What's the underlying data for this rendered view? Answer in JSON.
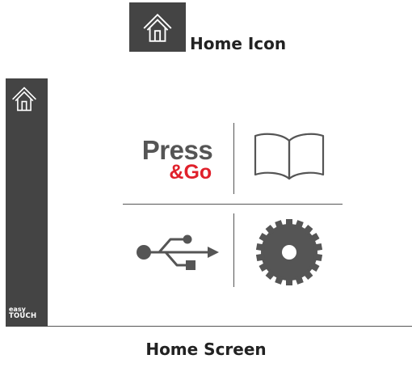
{
  "captions": {
    "icon_caption": "Home Icon",
    "screen_caption": "Home Screen"
  },
  "sidebar": {
    "home_icon": "home-icon",
    "brand": {
      "line1": "easy",
      "line2": "TOUCH"
    }
  },
  "tiles": {
    "press_go": {
      "press": "Press",
      "go": "&Go",
      "accent_color": "#e0202b"
    },
    "manual_icon": "book-icon",
    "usb_icon": "usb-icon",
    "settings_icon": "gear-icon"
  },
  "colors": {
    "sidebar": "#444444",
    "icon_gray": "#555555",
    "background": "#ffffff"
  }
}
